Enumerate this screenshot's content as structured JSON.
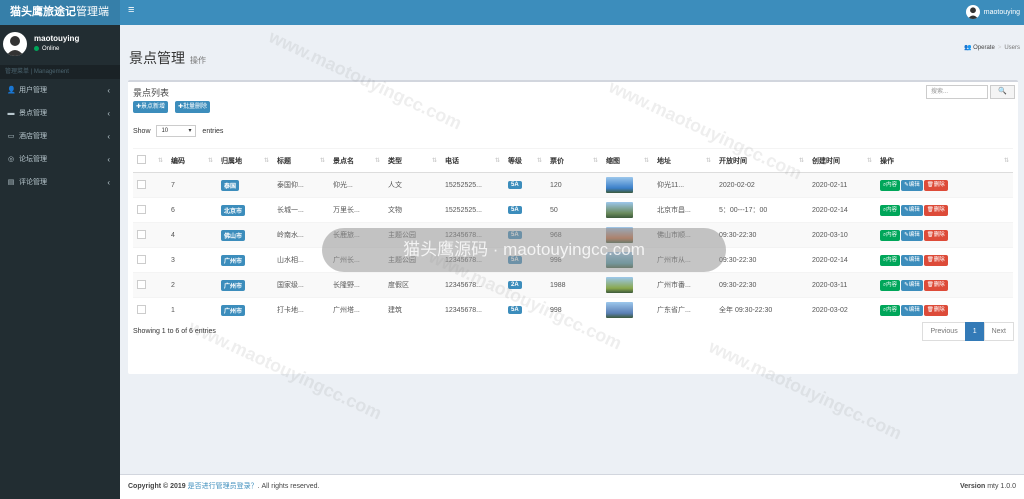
{
  "app": {
    "logo_bold": "猫头鹰旅途记",
    "logo_rest": "管理端"
  },
  "sidebar": {
    "user_name": "maotouying",
    "user_status": "Online",
    "menu_header": "管理菜单 | Management",
    "items": [
      {
        "label": "用户管理",
        "icon": "user-icon"
      },
      {
        "label": "景点管理",
        "icon": "book-icon"
      },
      {
        "label": "酒店管理",
        "icon": "bed-icon"
      },
      {
        "label": "论坛管理",
        "icon": "comments-icon"
      },
      {
        "label": "评论管理",
        "icon": "edit-icon"
      }
    ]
  },
  "header": {
    "user_name": "maotouying"
  },
  "page": {
    "title": "景点管理",
    "subtitle": "操作",
    "breadcrumb": [
      "Operate",
      "Users"
    ]
  },
  "box": {
    "title": "景点列表",
    "add_label": "✚景点新增",
    "batch_delete_label": "✚批量删除",
    "search_placeholder": "搜索...",
    "show_prefix": "Show",
    "show_value": "10",
    "show_suffix": "entries",
    "showing_text": "Showing 1 to 6 of 6 entries"
  },
  "table": {
    "headers": [
      "编码",
      "归属地",
      "标题",
      "景点名",
      "类型",
      "电话",
      "等级",
      "票价",
      "缩图",
      "地址",
      "开放时间",
      "创建时间",
      "操作"
    ],
    "rows": [
      {
        "id": "7",
        "region": "泰国",
        "title": "泰国仰...",
        "name": "仰光...",
        "type": "人文",
        "phone": "15252525...",
        "level": "5A",
        "price": "120",
        "thumb": "#3b7fc9",
        "addr": "仰光11...",
        "open": "2020-02-02",
        "created": "2020-02-11"
      },
      {
        "id": "6",
        "region": "北京市",
        "title": "长城一...",
        "name": "万里长...",
        "type": "文物",
        "phone": "15252525...",
        "level": "5A",
        "price": "50",
        "thumb": "#6a8a5c",
        "addr": "北京市昌...",
        "open": "5：00---17：00",
        "created": "2020-02-14"
      },
      {
        "id": "4",
        "region": "佛山市",
        "title": "岭南水...",
        "name": "长鹿旅...",
        "type": "主题公园",
        "phone": "12345678...",
        "level": "5A",
        "price": "968",
        "thumb": "#c96a3b",
        "addr": "佛山市顺...",
        "open": "09:30-22:30",
        "created": "2020-03-10"
      },
      {
        "id": "3",
        "region": "广州市",
        "title": "山水相...",
        "name": "广州长...",
        "type": "主题公园",
        "phone": "12345678...",
        "level": "5A",
        "price": "998",
        "thumb": "#4d9aa8",
        "addr": "广州市从...",
        "open": "09:30-22:30",
        "created": "2020-02-14"
      },
      {
        "id": "2",
        "region": "广州市",
        "title": "国家级...",
        "name": "长隆野...",
        "type": "度假区",
        "phone": "12345678...",
        "level": "2A",
        "price": "1988",
        "thumb": "#8aa84d",
        "addr": "广州市番...",
        "open": "09:30-22:30",
        "created": "2020-03-11"
      },
      {
        "id": "1",
        "region": "广州市",
        "title": "打卡地...",
        "name": "广州塔...",
        "type": "建筑",
        "phone": "12345678...",
        "level": "5A",
        "price": "998",
        "thumb": "#5a7fb5",
        "addr": "广东省广...",
        "open": "全年 09:30-22:30",
        "created": "2020-03-02"
      }
    ],
    "actions": {
      "view": "内容",
      "edit": "编辑",
      "delete": "删除"
    }
  },
  "pagination": {
    "prev": "Previous",
    "current": "1",
    "next": "Next"
  },
  "overlay": {
    "text": "猫头鹰源码 · maotouyingcc.com"
  },
  "watermark": {
    "text": "www.maotouyingcc.com"
  },
  "footer": {
    "copyright": "Copyright © 2019",
    "link": "是否进行管理员登录？",
    "rights": ". All rights reserved.",
    "version_label": "Version",
    "version": "mty 1.0.0"
  },
  "colors": {
    "brand": "#3c8dbc",
    "sidebar": "#222d32",
    "success": "#00a65a",
    "danger": "#dd4b39"
  }
}
